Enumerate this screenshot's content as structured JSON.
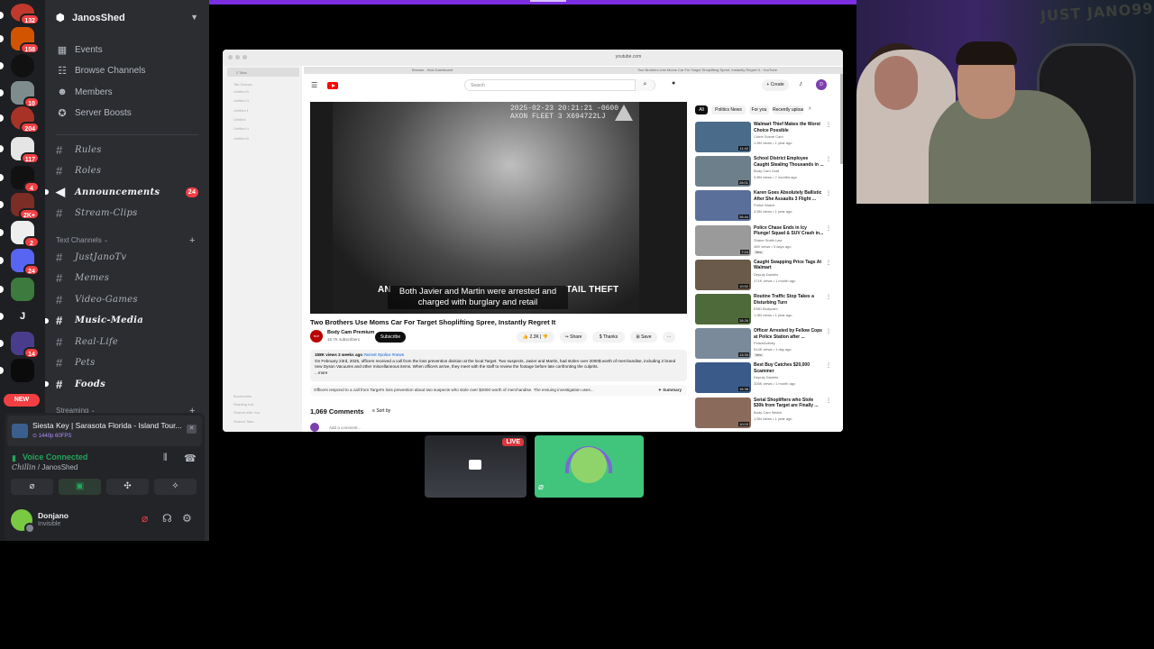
{
  "rail": {
    "servers": [
      {
        "color": "#c0392b",
        "badge": "132"
      },
      {
        "color": "#d35400",
        "badge": "158"
      },
      {
        "color": "#111111",
        "badge": ""
      },
      {
        "color": "#7f8c8d",
        "badge": "10"
      },
      {
        "color": "#a93226",
        "badge": "204"
      },
      {
        "color": "#e5e5e5",
        "badge": "117"
      },
      {
        "color": "#111111",
        "badge": "4"
      },
      {
        "color": "#7b2d26",
        "badge": "2K+"
      },
      {
        "color": "#eeeeee",
        "badge": "2"
      },
      {
        "color": "#5865f2",
        "badge": "24"
      },
      {
        "color": "#3d7a3d",
        "badge": ""
      },
      {
        "color": "#1e1f22",
        "badge": "",
        "letter": "J"
      },
      {
        "color": "#4a3c8c",
        "badge": "14"
      },
      {
        "color": "#0b0b0b",
        "badge": ""
      }
    ],
    "new_badge": "NEW"
  },
  "server": {
    "name": "JanosShed",
    "menu": [
      {
        "label": "Events",
        "icon": "calendar-icon",
        "glyph": "▦"
      },
      {
        "label": "Browse Channels",
        "icon": "browse-channels-icon",
        "glyph": "☷"
      },
      {
        "label": "Members",
        "icon": "members-icon",
        "glyph": "☻"
      },
      {
        "label": "Server Boosts",
        "icon": "boost-icon",
        "glyph": "✪"
      }
    ],
    "channels_top": [
      {
        "name": "Rules",
        "glyph": "#",
        "bold": false
      },
      {
        "name": "Roles",
        "glyph": "#",
        "bold": false
      },
      {
        "name": "Announcements",
        "glyph": "◀",
        "bold": true,
        "count": "24"
      },
      {
        "name": "Stream-Clips",
        "glyph": "#",
        "bold": false
      }
    ],
    "text_category": "Text Channels",
    "text_channels": [
      {
        "name": "JustJanoTv",
        "bold": false
      },
      {
        "name": "Memes",
        "bold": false
      },
      {
        "name": "Video-Games",
        "bold": false
      },
      {
        "name": "Music-Media",
        "bold": true
      },
      {
        "name": "Real-Life",
        "bold": false
      },
      {
        "name": "Pets",
        "bold": false
      },
      {
        "name": "Foods",
        "bold": true
      }
    ],
    "streaming_category": "Streaming"
  },
  "voice": {
    "activity_title": "Siesta Key | Sarasota Florida - Island Tour...",
    "activity_quality": "1440p 60FPS",
    "status": "Voice Connected",
    "channel": "Chillin",
    "server": "JanosShed"
  },
  "user": {
    "name": "Donjano",
    "status": "Invisible"
  },
  "browser": {
    "url": "youtube.com",
    "tabs": [
      "Browse - Kick Dashboard",
      "Two Brothers Use Moms Car For Target Shoplifting Spree, Instantly Regret It - YouTube"
    ],
    "tab_group": "2 Tabs",
    "side_title": "Tab Groups",
    "side_items": [
      "Untitled 5",
      "Untitled 3",
      "Untitled 1",
      "Untitled",
      "Untitled 4",
      "Untitled 6"
    ],
    "side_bottom": [
      "Bookmarks",
      "Reading List",
      "Shared with You",
      "Shared Tabs"
    ]
  },
  "youtube": {
    "search_placeholder": "Search",
    "create_label": "+ Create",
    "avatar_letter": "D",
    "video": {
      "timestamp": "2025-02-23 20:21:21 -0600",
      "device": "AXON FLEET 3 X694722LJ",
      "banner_left": "AN",
      "banner_right": "TAIL THEFT",
      "caption": "Both Javier and Martin were arrested and charged with burglary and retail"
    },
    "title": "Two Brothers Use Moms Car For Target Shoplifting Spree, Instantly Regret It",
    "channel": {
      "name": "Body Cam Premium",
      "subs": "15.7K subscribers",
      "avatar_text": "BCP"
    },
    "subscribe": "Subscribe",
    "likes": "2.3K",
    "share": "Share",
    "thanks": "Thanks",
    "save": "Save",
    "desc_stats": "158K views  3 weeks ago",
    "desc_tags": "#arrest #police #news",
    "desc_text": "On February 23rd, 2025, officers received a call from the loss prevention division at the local Target. Two suspects, Javier and Martin, had stolen over 2000$ worth of merchandise, including 2 brand new Dyson Vacuums and other miscellaneous items. When officers arrive, they meet with the staff to review the footage before late confronting the culprits.",
    "desc_more": "...more",
    "summary_text": "Officers respond to a call from Target's loss prevention about two suspects who stole over $2000 worth of merchandise. The ensuing investigation uses...",
    "summary_label": "✦ Summary",
    "comments": "1,069 Comments",
    "sort": "Sort by",
    "add_comment": "Add a comment...",
    "chips": [
      "All",
      "Politics News",
      "For you",
      "Recently uploaded"
    ],
    "recs": [
      {
        "title": "Walmart Thief Makes the Worst Choice Possible",
        "channel": "Crime Scene Cam",
        "meta": "1.9M views • 1 year ago",
        "dur": "11:42",
        "color": "#4a6b8a",
        "new": false
      },
      {
        "title": "School District Employee Caught Stealing Thousands in ...",
        "channel": "Body Cam Grail",
        "meta": "3.8M views • 7 months ago",
        "dur": "26:01",
        "color": "#6d7f8a",
        "new": false
      },
      {
        "title": "Karen Goes Absolutely Ballistic After She Assaults 3 Flight ...",
        "channel": "Police Watch",
        "meta": "3.5M views • 1 year ago",
        "dur": "26:44",
        "color": "#5a6f9a",
        "new": false
      },
      {
        "title": "Police Chase Ends in Icy Plunge! Squad & SUV Crash in...",
        "channel": "Shane Smith Law",
        "meta": "45K views • 3 days ago",
        "dur": "7:24",
        "color": "#9a9a9a",
        "new": true
      },
      {
        "title": "Caught Swapping Price Tags At Walmart",
        "channel": "Deputy Daniels",
        "meta": "171K views • 1 month ago",
        "dur": "10:52",
        "color": "#6a5a4a",
        "new": false
      },
      {
        "title": "Routine Traffic Stop Takes a Disturbing Turn",
        "channel": "EMD Bodycam",
        "meta": "1.9M views • 1 year ago",
        "dur": "28:26",
        "color": "#4f6a3a",
        "new": false
      },
      {
        "title": "Officer Arrested by Fellow Cops at Police Station after ...",
        "channel": "PoliceActivity",
        "meta": "514K views • 1 day ago",
        "dur": "13:33",
        "color": "#7a8a9a",
        "new": true
      },
      {
        "title": "Best Buy Catches $20,000 Scammer",
        "channel": "Deputy Daniels",
        "meta": "326K views • 1 month ago",
        "dur": "16:38",
        "color": "#3a5a8a",
        "new": false
      },
      {
        "title": "Serial Shoplifters who Stole $30k from Target are Finally ...",
        "channel": "Body Cam Watch",
        "meta": "1.5M views • 1 year ago",
        "dur": "10:03",
        "color": "#8a6a5a",
        "new": false
      }
    ]
  },
  "tiles": {
    "live_label": "LIVE"
  },
  "cam": {
    "wall_text": "JUST JANO99"
  }
}
